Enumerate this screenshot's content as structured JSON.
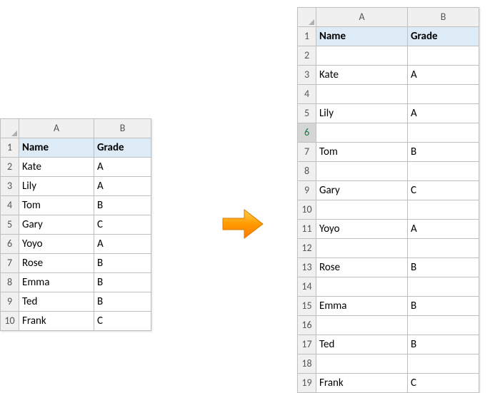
{
  "leftTable": {
    "columns": [
      "A",
      "B"
    ],
    "headers": {
      "name": "Name",
      "grade": "Grade"
    },
    "rows": [
      {
        "n": "1"
      },
      {
        "n": "2",
        "name": "Kate",
        "grade": "A"
      },
      {
        "n": "3",
        "name": "Lily",
        "grade": "A"
      },
      {
        "n": "4",
        "name": "Tom",
        "grade": "B"
      },
      {
        "n": "5",
        "name": "Gary",
        "grade": "C"
      },
      {
        "n": "6",
        "name": "Yoyo",
        "grade": "A"
      },
      {
        "n": "7",
        "name": "Rose",
        "grade": "B"
      },
      {
        "n": "8",
        "name": "Emma",
        "grade": "B"
      },
      {
        "n": "9",
        "name": "Ted",
        "grade": "B"
      },
      {
        "n": "10",
        "name": "Frank",
        "grade": "C"
      }
    ]
  },
  "rightTable": {
    "columns": [
      "A",
      "B"
    ],
    "headers": {
      "name": "Name",
      "grade": "Grade"
    },
    "selectedRow": "6",
    "rows": [
      {
        "n": "1"
      },
      {
        "n": "2",
        "name": "",
        "grade": ""
      },
      {
        "n": "3",
        "name": "Kate",
        "grade": "A"
      },
      {
        "n": "4",
        "name": "",
        "grade": ""
      },
      {
        "n": "5",
        "name": "Lily",
        "grade": "A"
      },
      {
        "n": "6",
        "name": "",
        "grade": ""
      },
      {
        "n": "7",
        "name": "Tom",
        "grade": "B"
      },
      {
        "n": "8",
        "name": "",
        "grade": ""
      },
      {
        "n": "9",
        "name": "Gary",
        "grade": "C"
      },
      {
        "n": "10",
        "name": "",
        "grade": ""
      },
      {
        "n": "11",
        "name": "Yoyo",
        "grade": "A"
      },
      {
        "n": "12",
        "name": "",
        "grade": ""
      },
      {
        "n": "13",
        "name": "Rose",
        "grade": "B"
      },
      {
        "n": "14",
        "name": "",
        "grade": ""
      },
      {
        "n": "15",
        "name": "Emma",
        "grade": "B"
      },
      {
        "n": "16",
        "name": "",
        "grade": ""
      },
      {
        "n": "17",
        "name": "Ted",
        "grade": "B"
      },
      {
        "n": "18",
        "name": "",
        "grade": ""
      },
      {
        "n": "19",
        "name": "Frank",
        "grade": "C"
      }
    ]
  }
}
